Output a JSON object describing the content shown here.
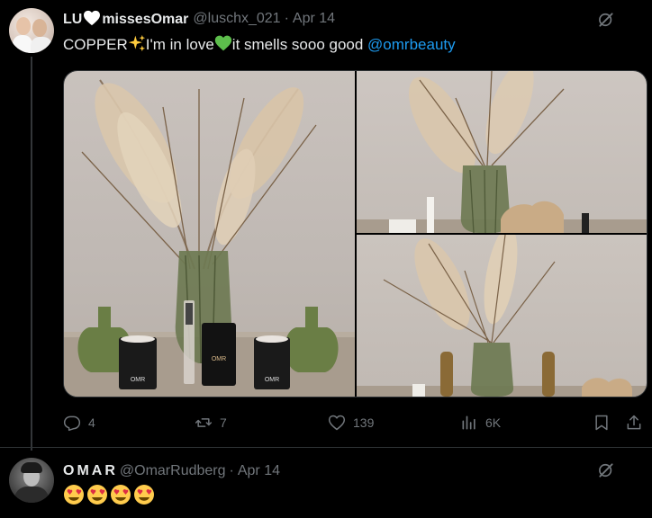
{
  "tweet": {
    "author_name_part1": "LU",
    "author_name_part2": "missesOmar",
    "handle": "@luschx_021",
    "separator": "·",
    "date": "Apr 14",
    "text_part1": "COPPER",
    "text_part2": "I'm in love",
    "text_part3": "it smells sooo good ",
    "mention": "@omrbeauty",
    "images": [
      {
        "label_main": "OMR",
        "candle_label": "OMR"
      },
      {
        "label": "OMR"
      }
    ],
    "stats": {
      "replies": "4",
      "reposts": "7",
      "likes": "139",
      "views": "6K"
    }
  },
  "reply": {
    "author_name": "OMAR",
    "handle": "@OmarRudberg",
    "separator": "·",
    "date": "Apr 14",
    "emoji_count": 4
  },
  "colors": {
    "background": "#000000",
    "text": "#e7e9ea",
    "muted": "#71767b",
    "link": "#1d9bf0",
    "border": "#2f3336"
  },
  "icons": {
    "grok": "grok-icon",
    "reply": "reply-icon",
    "repost": "repost-icon",
    "like": "heart-icon",
    "views": "views-icon",
    "bookmark": "bookmark-icon",
    "share": "share-icon"
  }
}
